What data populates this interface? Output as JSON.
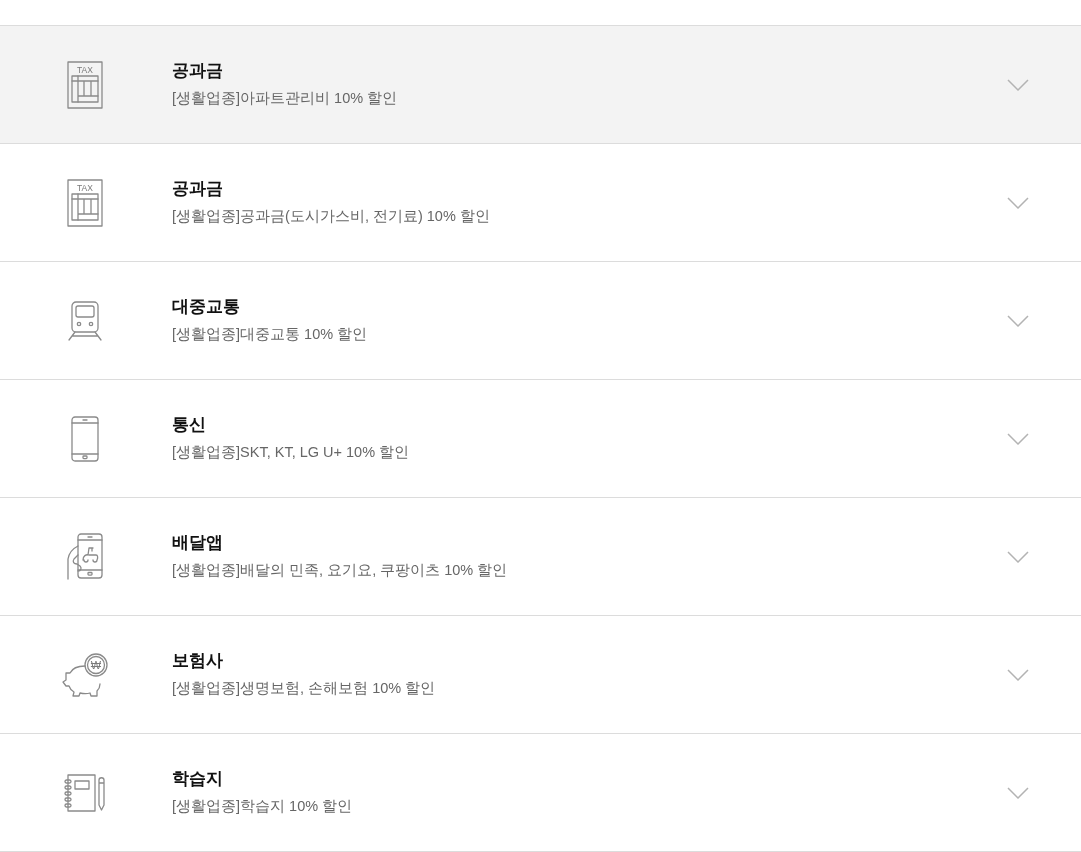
{
  "items": [
    {
      "kind": "tax",
      "icon_text": "TAX",
      "title": "공과금",
      "description": "[생활업종]아파트관리비 10% 할인",
      "highlighted": true
    },
    {
      "kind": "tax",
      "icon_text": "TAX",
      "title": "공과금",
      "description": "[생활업종]공과금(도시가스비, 전기료) 10% 할인",
      "highlighted": false
    },
    {
      "kind": "train",
      "title": "대중교통",
      "description": "[생활업종]대중교통 10% 할인",
      "highlighted": false
    },
    {
      "kind": "phone",
      "title": "통신",
      "description": "[생활업종]SKT, KT, LG U+ 10% 할인",
      "highlighted": false
    },
    {
      "kind": "delivery",
      "title": "배달앱",
      "description": "[생활업종]배달의 민족, 요기요, 쿠팡이츠 10% 할인",
      "highlighted": false
    },
    {
      "kind": "piggy",
      "icon_text": "₩",
      "title": "보험사",
      "description": "[생활업종]생명보험, 손해보험 10% 할인",
      "highlighted": false
    },
    {
      "kind": "notebook",
      "title": "학습지",
      "description": "[생활업종]학습지 10% 할인",
      "highlighted": false
    }
  ]
}
